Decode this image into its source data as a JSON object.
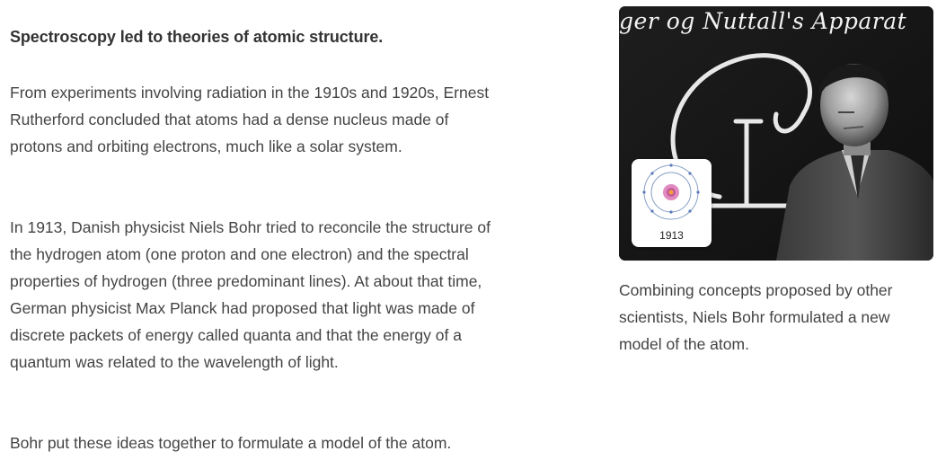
{
  "article": {
    "heading": "Spectroscopy led to theories of atomic structure.",
    "paragraphs": [
      "From experiments involving radiation in the 1910s and 1920s, Ernest Rutherford concluded that atoms had a dense nucleus made of protons and orbiting electrons, much like a solar system.",
      "In 1913, Danish physicist Niels Bohr tried to reconcile the structure of the hydrogen atom (one proton and one electron) and the spectral properties of hydrogen (three predominant lines). At about that time, German physicist Max Planck had proposed that light was made of discrete packets of energy called quanta and that the energy of a quantum was related to the wavelength of light.",
      "Bohr put these ideas together to formulate a model of the atom."
    ]
  },
  "figure": {
    "board_text": "ger og Nuttall's Apparat",
    "inset_year": "1913",
    "caption": "Combining concepts proposed by other scientists, Niels Bohr formulated a new model of the atom."
  }
}
